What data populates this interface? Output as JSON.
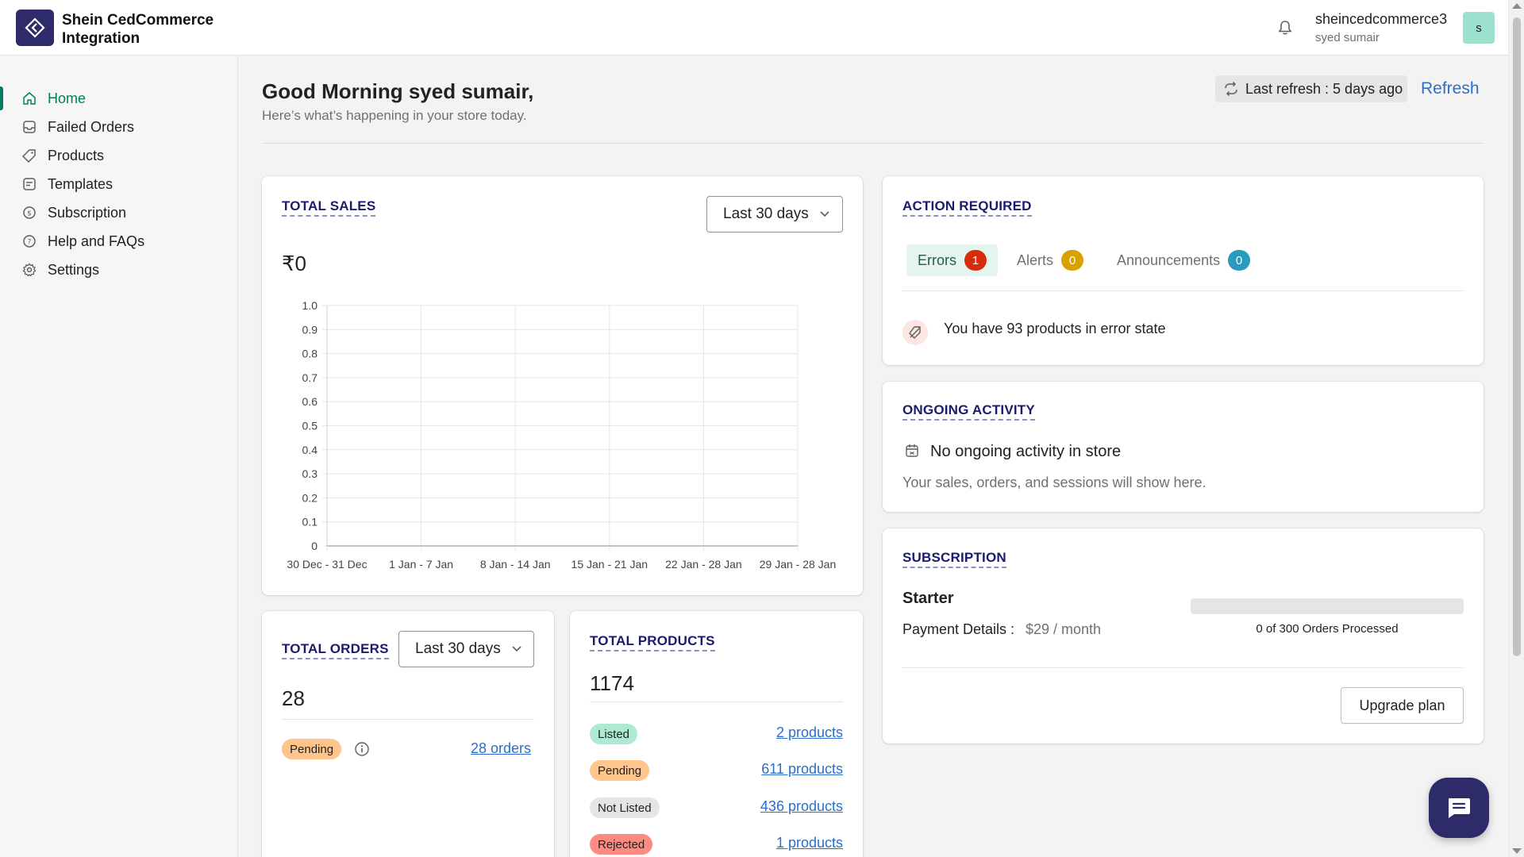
{
  "app": {
    "title": "Shein CedCommerce Integration",
    "brand_color": "#2d2b69"
  },
  "header": {
    "store_name": "sheincedcommerce3",
    "user_name": "syed sumair",
    "avatar_letter": "s",
    "notification_icon": "bell-icon"
  },
  "sidebar": {
    "items": [
      {
        "label": "Home",
        "icon": "home-icon",
        "active": true
      },
      {
        "label": "Failed Orders",
        "icon": "inbox-icon"
      },
      {
        "label": "Products",
        "icon": "tag-icon"
      },
      {
        "label": "Templates",
        "icon": "template-icon"
      },
      {
        "label": "Subscription",
        "icon": "dollar-icon"
      },
      {
        "label": "Help and FAQs",
        "icon": "help-icon"
      },
      {
        "label": "Settings",
        "icon": "gear-icon"
      }
    ]
  },
  "page": {
    "greeting": "Good Morning syed sumair,",
    "subtitle": "Here’s what’s happening in your store today.",
    "last_refresh": "Last refresh : 5 days ago",
    "refresh_label": "Refresh"
  },
  "sales": {
    "title": "TOTAL SALES",
    "range": "Last 30 days",
    "amount": "₹0"
  },
  "chart_data": {
    "type": "line",
    "title": "",
    "xlabel": "",
    "ylabel": "",
    "categories": [
      "30 Dec - 31 Dec",
      "1 Jan - 7 Jan",
      "8 Jan - 14 Jan",
      "15 Jan - 21 Jan",
      "22 Jan - 28 Jan",
      "29 Jan - 28 Jan"
    ],
    "values": [
      0,
      0,
      0,
      0,
      0,
      0
    ],
    "yticks": [
      "0",
      "0.1",
      "0.2",
      "0.3",
      "0.4",
      "0.5",
      "0.6",
      "0.7",
      "0.8",
      "0.9",
      "1.0"
    ],
    "ylim": [
      0,
      1
    ],
    "grid": true
  },
  "orders": {
    "title": "TOTAL ORDERS",
    "range": "Last 30 days",
    "count": "28",
    "pending_label": "Pending",
    "pending_link": "28 orders"
  },
  "products": {
    "title": "TOTAL PRODUCTS",
    "count": "1174",
    "rows": [
      {
        "status": "Listed",
        "link": "2 products",
        "color": "#aee9d1"
      },
      {
        "status": "Pending",
        "link": "611 products",
        "color": "#ffc58b"
      },
      {
        "status": "Not Listed",
        "link": "436 products",
        "color": "#e4e5e7"
      },
      {
        "status": "Rejected",
        "link": "1 products",
        "color": "#fd8b82"
      }
    ]
  },
  "action": {
    "title": "ACTION REQUIRED",
    "tabs": [
      {
        "label": "Errors",
        "count": "1",
        "color": "#d72c0d"
      },
      {
        "label": "Alerts",
        "count": "0",
        "color": "#d9a100"
      },
      {
        "label": "Announcements",
        "count": "0",
        "color": "#2a9bc0"
      }
    ],
    "message": "You have 93 products in error state"
  },
  "activity": {
    "title": "ONGOING ACTIVITY",
    "heading": "No ongoing activity in store",
    "text": "Your sales, orders, and sessions will show here."
  },
  "subscription": {
    "title": "SUBSCRIPTION",
    "plan": "Starter",
    "payment_label": "Payment Details :",
    "price": "$29 / month",
    "usage": "0 of 300 Orders Processed",
    "usage_fraction": 0,
    "upgrade_label": "Upgrade plan"
  }
}
